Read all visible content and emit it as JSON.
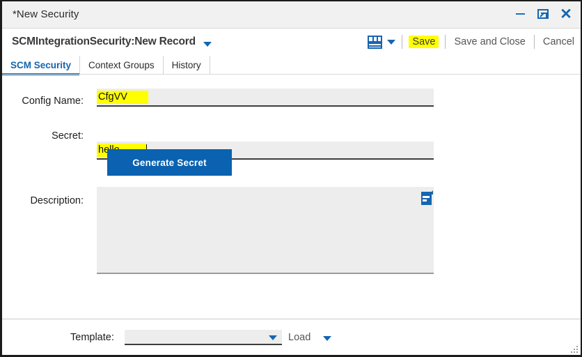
{
  "window": {
    "title": "*New Security",
    "controls": {
      "minimize": "minimize-icon",
      "restore": "restore-icon",
      "close": "close-icon"
    }
  },
  "commandbar": {
    "record_title": "SCMIntegrationSecurity:New Record",
    "record_caret": "chevron-down-icon",
    "layout_icon": "grid-layout-icon",
    "layout_caret": "chevron-down-icon",
    "save_label": "Save",
    "save_and_close_label": "Save and Close",
    "cancel_label": "Cancel",
    "highlight_color": "#ffff00"
  },
  "tabs": [
    {
      "label": "SCM Security",
      "active": true
    },
    {
      "label": "Context Groups",
      "active": false
    },
    {
      "label": "History",
      "active": false
    }
  ],
  "form": {
    "config_name": {
      "label": "Config Name:",
      "value": "CfgVV",
      "placeholder": ""
    },
    "secret": {
      "label": "Secret:",
      "value": "hello",
      "placeholder": "",
      "has_cursor": true
    },
    "generate_secret_label": "Generate Secret",
    "description": {
      "label": "Description:",
      "value": "",
      "placeholder": "",
      "editor_icon": "document-editor-icon"
    }
  },
  "footer": {
    "template_label": "Template:",
    "template_value": "",
    "template_caret": "chevron-down-icon",
    "load_label": "Load",
    "load_caret": "chevron-down-icon",
    "resize_grip": "resize-grip-icon"
  },
  "colors": {
    "accent_blue": "#1565b0",
    "button_blue": "#0a62b0",
    "highlight_yellow": "#ffff00",
    "field_gray": "#ededed"
  }
}
